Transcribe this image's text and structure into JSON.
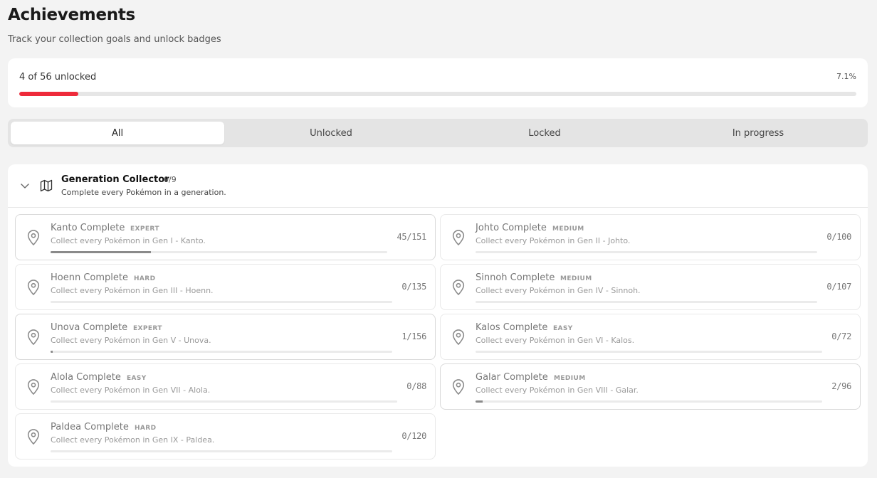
{
  "page": {
    "title": "Achievements",
    "subtitle": "Track your collection goals and unlock badges"
  },
  "summary": {
    "label": "4 of 56 unlocked",
    "percent": "7.1%",
    "progress": 0.071,
    "accent_color": "#ee2a3a"
  },
  "tabs": [
    {
      "label": "All",
      "active": true
    },
    {
      "label": "Unlocked",
      "active": false
    },
    {
      "label": "Locked",
      "active": false
    },
    {
      "label": "In progress",
      "active": false
    }
  ],
  "group": {
    "title": "Generation Collector",
    "count": "0/9",
    "description": "Complete every Pokémon in a generation.",
    "icon": "map-icon",
    "expand_icon": "chevron-down-icon"
  },
  "achievements": [
    {
      "name": "Kanto Complete",
      "difficulty": "EXPERT",
      "description": "Collect every Pokémon in Gen I - Kanto.",
      "count": "45/151",
      "progress": 0.298,
      "in_progress": true
    },
    {
      "name": "Johto Complete",
      "difficulty": "MEDIUM",
      "description": "Collect every Pokémon in Gen II - Johto.",
      "count": "0/100",
      "progress": 0,
      "in_progress": false
    },
    {
      "name": "Hoenn Complete",
      "difficulty": "HARD",
      "description": "Collect every Pokémon in Gen III - Hoenn.",
      "count": "0/135",
      "progress": 0,
      "in_progress": false
    },
    {
      "name": "Sinnoh Complete",
      "difficulty": "MEDIUM",
      "description": "Collect every Pokémon in Gen IV - Sinnoh.",
      "count": "0/107",
      "progress": 0,
      "in_progress": false
    },
    {
      "name": "Unova Complete",
      "difficulty": "EXPERT",
      "description": "Collect every Pokémon in Gen V - Unova.",
      "count": "1/156",
      "progress": 0.0064,
      "in_progress": true
    },
    {
      "name": "Kalos Complete",
      "difficulty": "EASY",
      "description": "Collect every Pokémon in Gen VI - Kalos.",
      "count": "0/72",
      "progress": 0,
      "in_progress": false
    },
    {
      "name": "Alola Complete",
      "difficulty": "EASY",
      "description": "Collect every Pokémon in Gen VII - Alola.",
      "count": "0/88",
      "progress": 0,
      "in_progress": false
    },
    {
      "name": "Galar Complete",
      "difficulty": "MEDIUM",
      "description": "Collect every Pokémon in Gen VIII - Galar.",
      "count": "2/96",
      "progress": 0.0208,
      "in_progress": true
    },
    {
      "name": "Paldea Complete",
      "difficulty": "HARD",
      "description": "Collect every Pokémon in Gen IX - Paldea.",
      "count": "0/120",
      "progress": 0,
      "in_progress": false
    }
  ]
}
